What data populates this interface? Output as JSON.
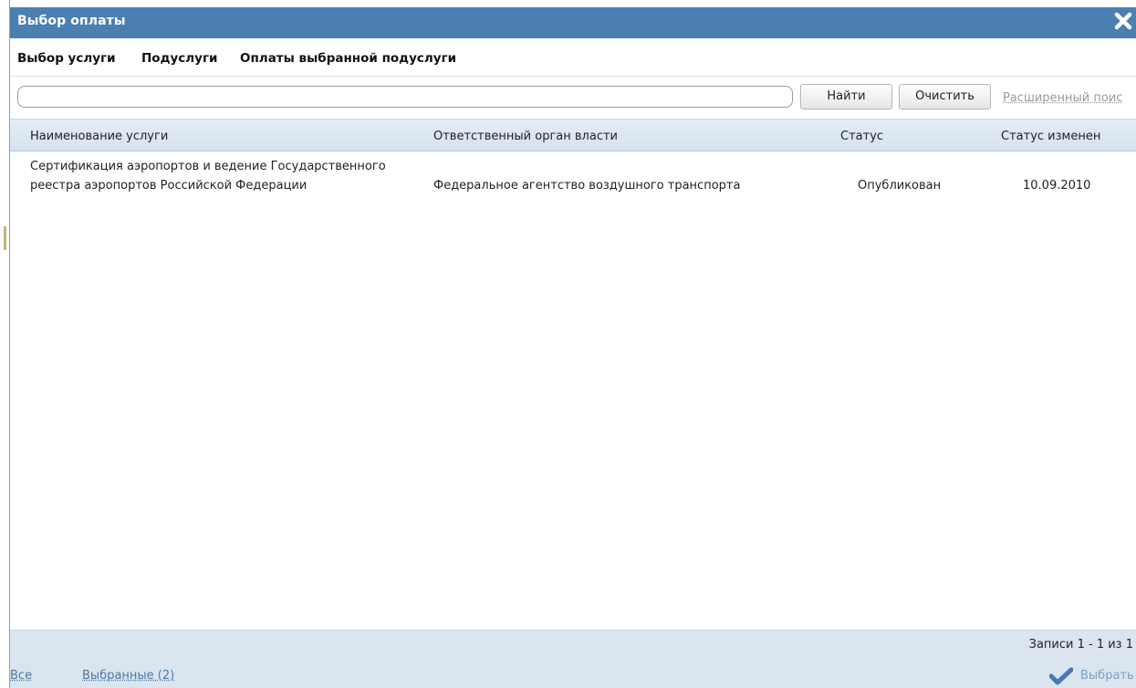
{
  "dialog": {
    "title": "Выбор оплаты"
  },
  "tabs": [
    {
      "label": "Выбор услуги"
    },
    {
      "label": "Подуслуги"
    },
    {
      "label": "Оплаты выбранной подуслуги"
    }
  ],
  "search": {
    "value": "",
    "placeholder": "",
    "find_label": "Найти",
    "clear_label": "Очистить",
    "advanced_label": "Расширенный поис"
  },
  "table": {
    "headers": [
      "Наименование услуги",
      "Ответственный орган власти",
      "Статус",
      "Статус изменен"
    ],
    "rows": [
      {
        "name": "Сертификация аэропортов и ведение Государственного реестра аэропортов Российской Федерации",
        "org": "Федеральное агентство воздушного транспорта",
        "status": "Опубликован",
        "changed": "10.09.2010"
      }
    ]
  },
  "footer": {
    "records": "Записи 1 - 1 из 1",
    "all_label": "Все",
    "selected_label": "Выбранные (2)",
    "select_label": "Выбрать"
  },
  "icons": {
    "close": "close-icon",
    "check": "check-icon"
  },
  "colors": {
    "titlebar": "#4b7fb2",
    "header_bg": "#dbe5ef",
    "link": "#4a78a8"
  }
}
